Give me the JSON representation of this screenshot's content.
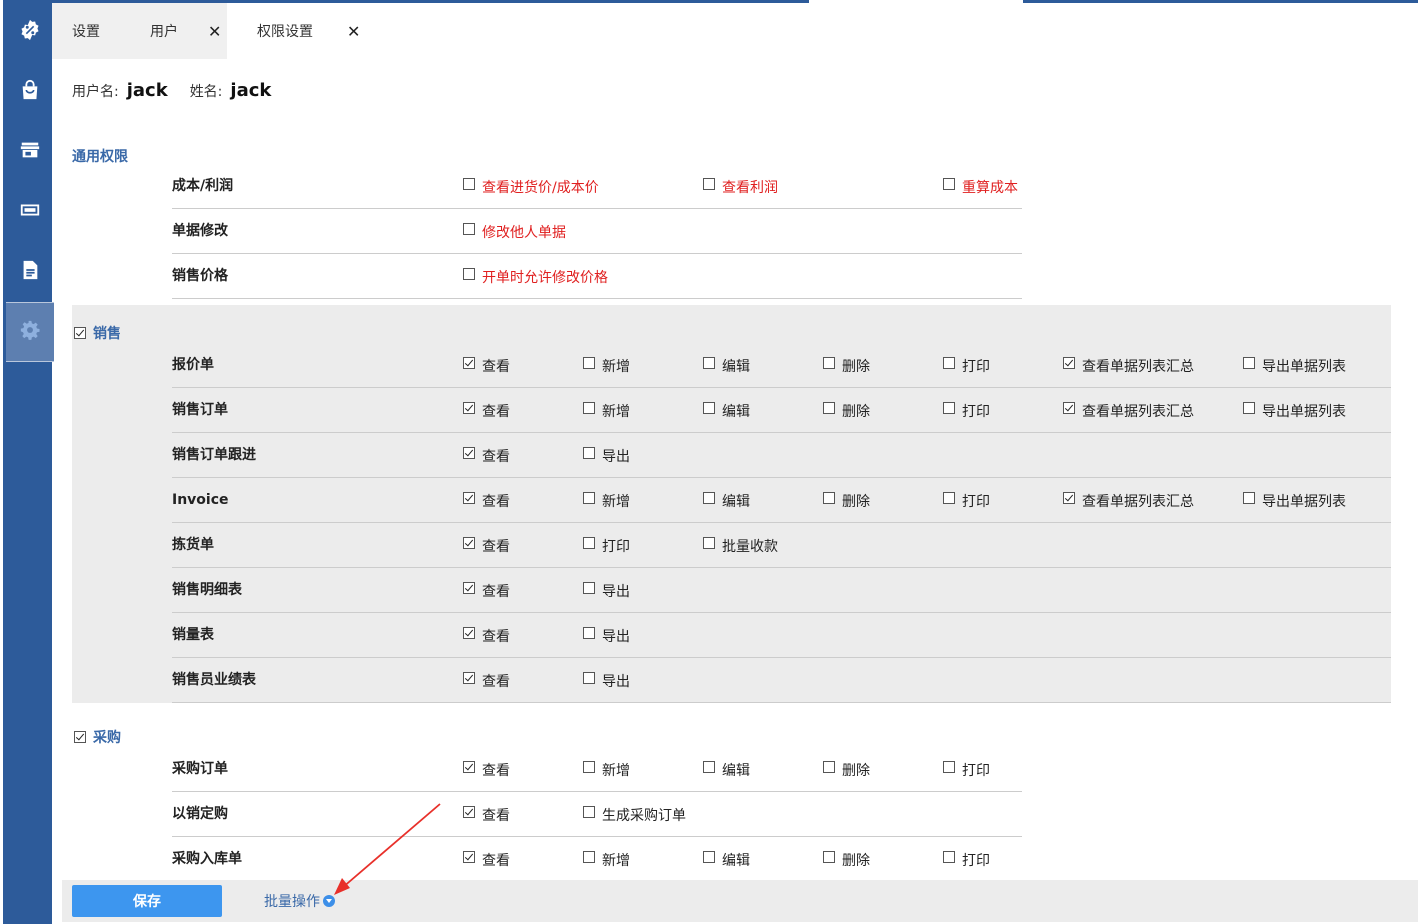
{
  "tabs": [
    {
      "label": "设置",
      "closable": false
    },
    {
      "label": "用户",
      "closable": true
    },
    {
      "label": "权限设置",
      "closable": true,
      "active": true
    }
  ],
  "close_glyph": "✕",
  "sidebar": {
    "items": [
      {
        "icon": "percent-badge-icon"
      },
      {
        "icon": "shopping-bag-icon"
      },
      {
        "icon": "store-icon"
      },
      {
        "icon": "cash-icon"
      },
      {
        "icon": "document-icon"
      },
      {
        "icon": "gear-icon",
        "active": true
      }
    ]
  },
  "user": {
    "username_label": "用户名:",
    "username": "jack",
    "name_label": "姓名:",
    "name": "jack"
  },
  "general": {
    "title": "通用权限",
    "rows": [
      {
        "label": "成本/利润",
        "options": [
          {
            "text": "查看进货价/成本价",
            "checked": false
          },
          {
            "text": "查看利润",
            "checked": false
          },
          {
            "text": "重算成本",
            "checked": false
          }
        ]
      },
      {
        "label": "单据修改",
        "options": [
          {
            "text": "修改他人单据",
            "checked": false
          }
        ]
      },
      {
        "label": "销售价格",
        "options": [
          {
            "text": "开单时允许修改价格",
            "checked": false
          }
        ]
      }
    ]
  },
  "sales": {
    "title": "销售",
    "checked": true,
    "rows": [
      {
        "label": "报价单",
        "options": [
          {
            "text": "查看",
            "checked": true
          },
          {
            "text": "新增",
            "checked": false
          },
          {
            "text": "编辑",
            "checked": false
          },
          {
            "text": "删除",
            "checked": false
          },
          {
            "text": "打印",
            "checked": false
          },
          {
            "text": "查看单据列表汇总",
            "checked": true
          },
          {
            "text": "导出单据列表",
            "checked": false
          }
        ]
      },
      {
        "label": "销售订单",
        "options": [
          {
            "text": "查看",
            "checked": true
          },
          {
            "text": "新增",
            "checked": false
          },
          {
            "text": "编辑",
            "checked": false
          },
          {
            "text": "删除",
            "checked": false
          },
          {
            "text": "打印",
            "checked": false
          },
          {
            "text": "查看单据列表汇总",
            "checked": true
          },
          {
            "text": "导出单据列表",
            "checked": false
          }
        ]
      },
      {
        "label": "销售订单跟进",
        "options": [
          {
            "text": "查看",
            "checked": true
          },
          {
            "text": "导出",
            "checked": false
          }
        ]
      },
      {
        "label": "Invoice",
        "options": [
          {
            "text": "查看",
            "checked": true
          },
          {
            "text": "新增",
            "checked": false
          },
          {
            "text": "编辑",
            "checked": false
          },
          {
            "text": "删除",
            "checked": false
          },
          {
            "text": "打印",
            "checked": false
          },
          {
            "text": "查看单据列表汇总",
            "checked": true
          },
          {
            "text": "导出单据列表",
            "checked": false
          }
        ]
      },
      {
        "label": "拣货单",
        "options": [
          {
            "text": "查看",
            "checked": true
          },
          {
            "text": "打印",
            "checked": false
          },
          {
            "text": "批量收款",
            "checked": false
          }
        ]
      },
      {
        "label": "销售明细表",
        "options": [
          {
            "text": "查看",
            "checked": true
          },
          {
            "text": "导出",
            "checked": false
          }
        ]
      },
      {
        "label": "销量表",
        "options": [
          {
            "text": "查看",
            "checked": true
          },
          {
            "text": "导出",
            "checked": false
          }
        ]
      },
      {
        "label": "销售员业绩表",
        "options": [
          {
            "text": "查看",
            "checked": true
          },
          {
            "text": "导出",
            "checked": false
          }
        ]
      }
    ]
  },
  "purchase": {
    "title": "采购",
    "checked": true,
    "rows": [
      {
        "label": "采购订单",
        "options": [
          {
            "text": "查看",
            "checked": true
          },
          {
            "text": "新增",
            "checked": false
          },
          {
            "text": "编辑",
            "checked": false
          },
          {
            "text": "删除",
            "checked": false
          },
          {
            "text": "打印",
            "checked": false
          }
        ]
      },
      {
        "label": "以销定购",
        "options": [
          {
            "text": "查看",
            "checked": true
          },
          {
            "text": "生成采购订单",
            "checked": false
          }
        ]
      },
      {
        "label": "采购入库单",
        "options": [
          {
            "text": "查看",
            "checked": true
          },
          {
            "text": "新增",
            "checked": false
          },
          {
            "text": "编辑",
            "checked": false
          },
          {
            "text": "删除",
            "checked": false
          },
          {
            "text": "打印",
            "checked": false
          }
        ]
      }
    ]
  },
  "footer": {
    "save_label": "保存",
    "batch_label": "批量操作"
  },
  "colors": {
    "sidebar": "#2d5b9a",
    "accent": "#3a69a8",
    "warning_text": "#e02020",
    "save_button": "#3d96ef",
    "annotation_arrow": "#e8302a"
  }
}
